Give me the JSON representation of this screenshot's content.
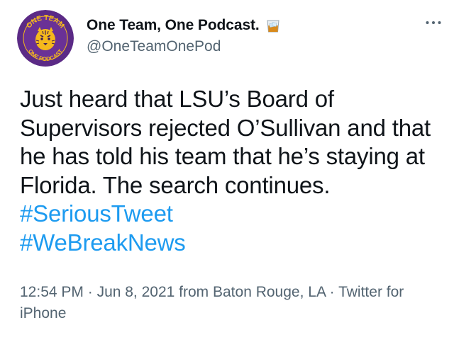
{
  "author": {
    "display_name": "One Team, One Podcast.",
    "handle": "@OneTeamOnePod",
    "avatar_text_top": "ONE TEAM",
    "avatar_text_bottom": "ONE PODCAST",
    "name_emoji": "whisky-glass-icon"
  },
  "tweet": {
    "text_plain": "Just heard that LSU’s Board of Supervisors rejected O’Sullivan and that he has told his team that he’s staying at Florida. The search continues. ",
    "hashtags": [
      "#SeriousTweet",
      "#WeBreakNews"
    ]
  },
  "meta": {
    "time": "12:54 PM",
    "separator": " · ",
    "date": "Jun 8, 2021",
    "location": " from Baton Rouge, LA",
    "source": "Twitter for iPhone"
  },
  "colors": {
    "link": "#1d9bf0",
    "secondary_text": "#536471",
    "avatar_purple": "#5b2a86",
    "avatar_gold": "#f5b91c"
  },
  "icons": {
    "more": "more-horizontal-icon"
  }
}
